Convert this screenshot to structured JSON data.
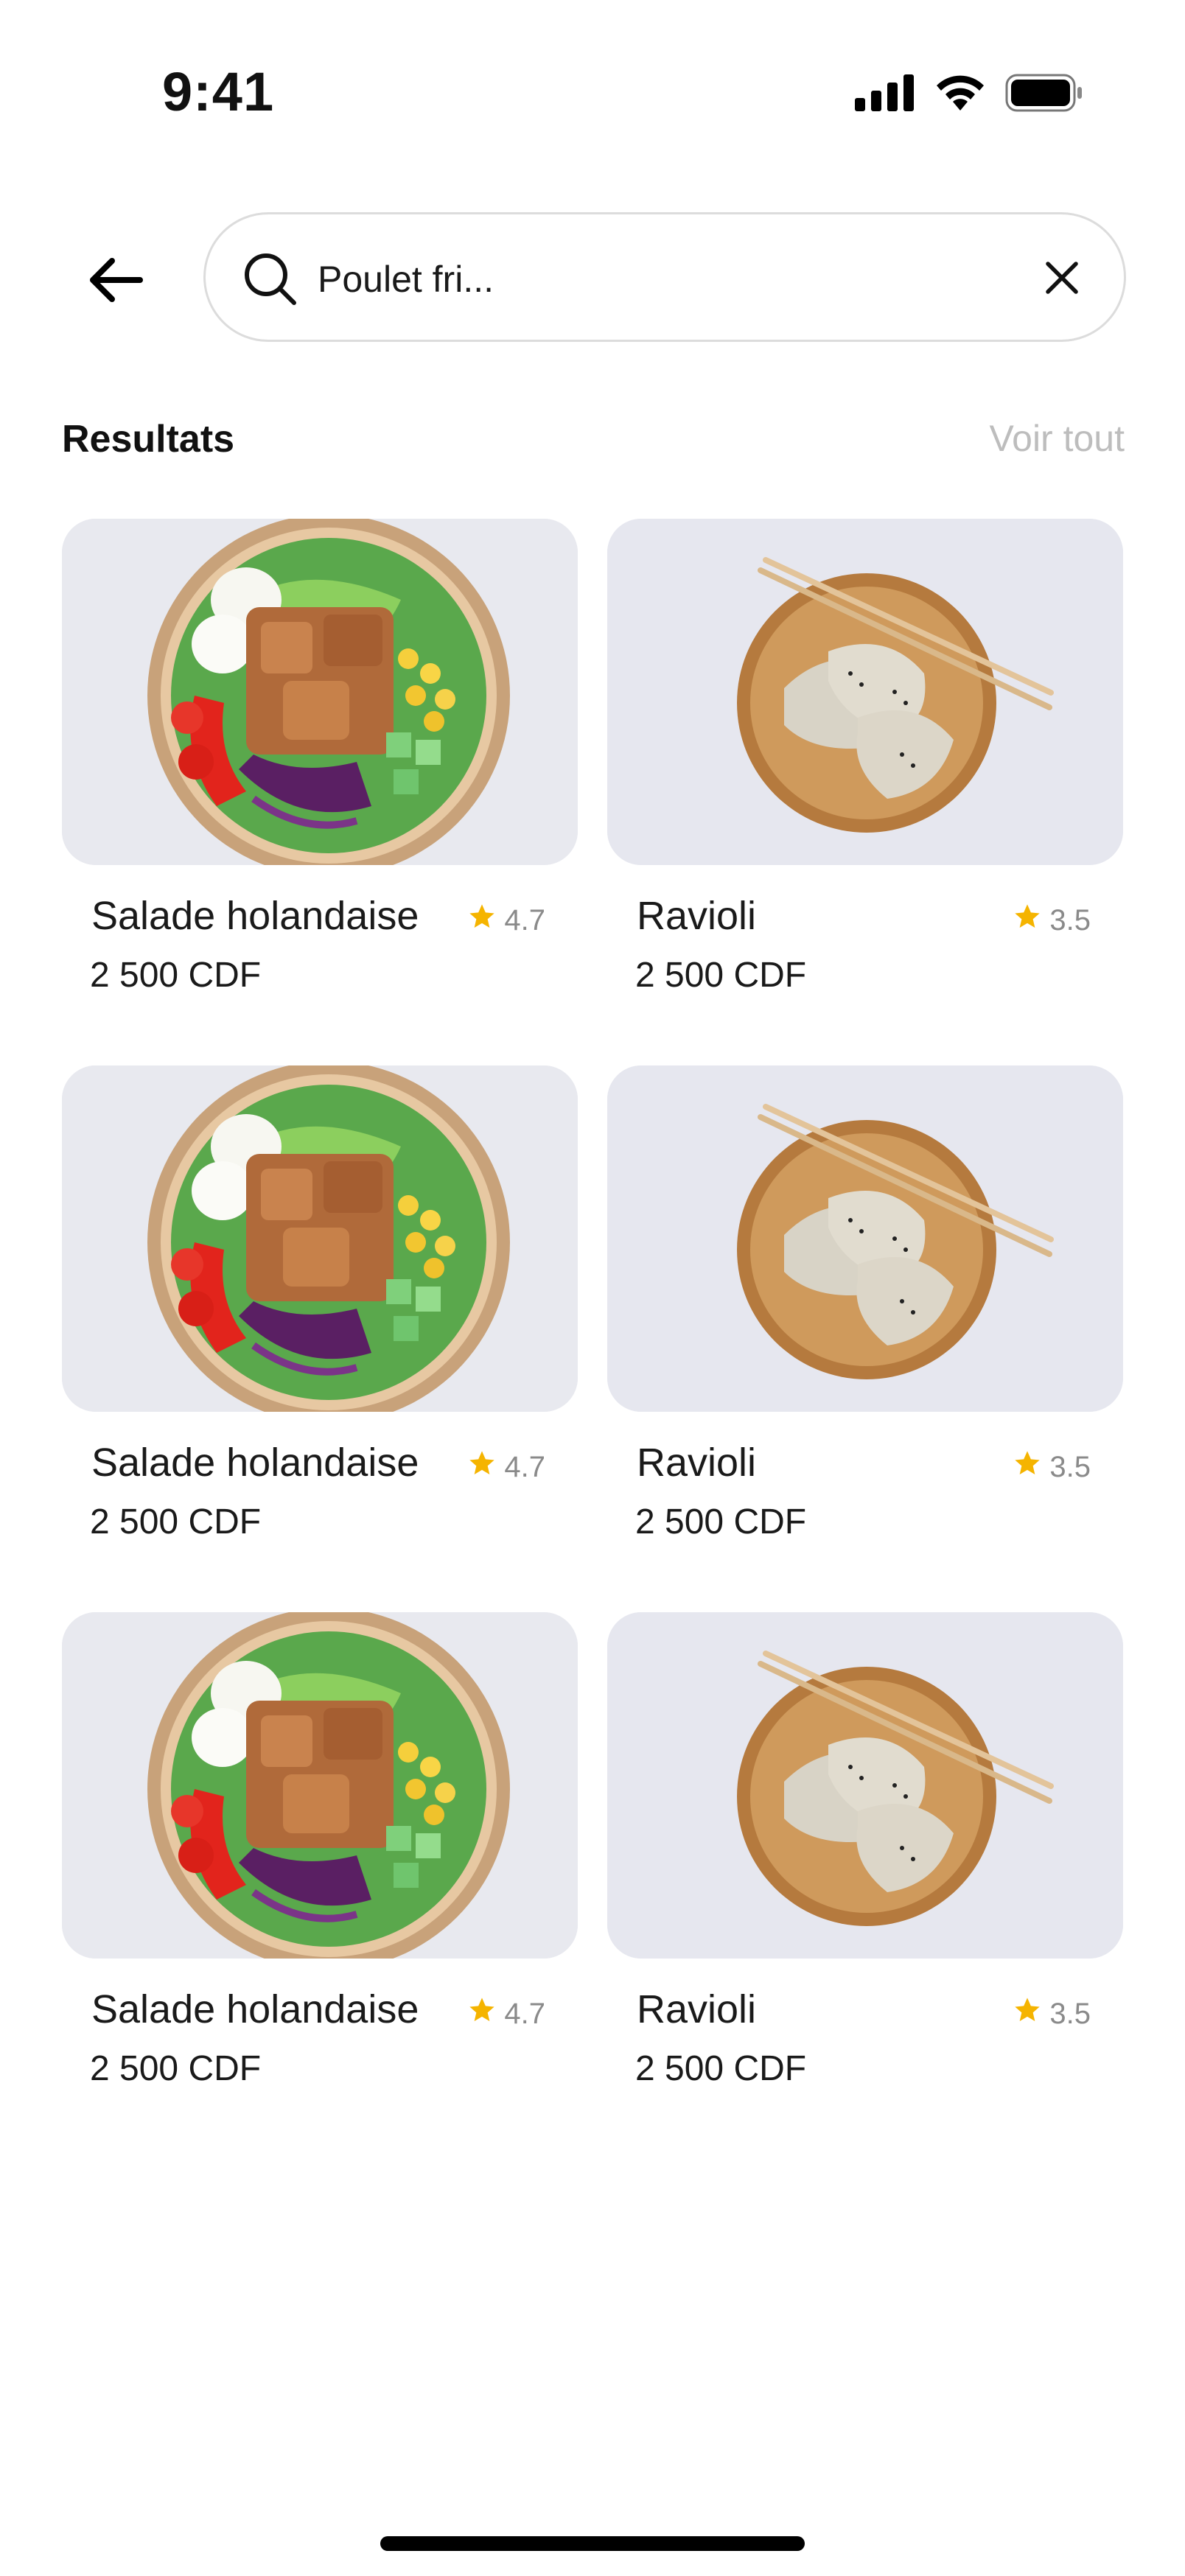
{
  "status_bar": {
    "time": "9:41",
    "icons": [
      "cellular-signal-icon",
      "wifi-icon",
      "battery-icon"
    ]
  },
  "header": {
    "back_icon": "arrow-left-icon",
    "search": {
      "icon": "search-icon",
      "value": "Poulet fri...",
      "clear_icon": "close-icon"
    }
  },
  "results": {
    "title": "Resultats",
    "see_all": "Voir tout",
    "items": [
      {
        "name": "Salade holandaise",
        "rating": "4.7",
        "price": "2 500 CDF",
        "image": "salad-bowl"
      },
      {
        "name": "Ravioli",
        "rating": "3.5",
        "price": "2 500 CDF",
        "image": "ravioli-plate"
      },
      {
        "name": "Salade holandaise",
        "rating": "4.7",
        "price": "2 500 CDF",
        "image": "salad-bowl"
      },
      {
        "name": "Ravioli",
        "rating": "3.5",
        "price": "2 500 CDF",
        "image": "ravioli-plate"
      },
      {
        "name": "Salade holandaise",
        "rating": "4.7",
        "price": "2 500 CDF",
        "image": "salad-bowl"
      },
      {
        "name": "Ravioli",
        "rating": "3.5",
        "price": "2 500 CDF",
        "image": "ravioli-plate"
      }
    ]
  },
  "colors": {
    "star": "#f5b400",
    "muted_text": "#bdbdbd",
    "search_border": "#dcdcdc"
  }
}
